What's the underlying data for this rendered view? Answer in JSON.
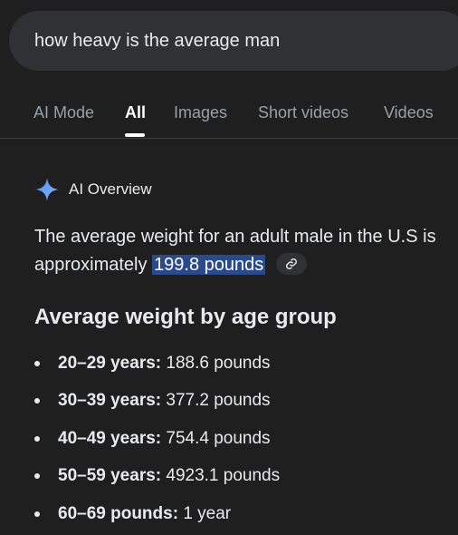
{
  "search": {
    "query": "how heavy is the average man"
  },
  "tabs": [
    {
      "label": "AI Mode",
      "active": false
    },
    {
      "label": "All",
      "active": true
    },
    {
      "label": "Images",
      "active": false
    },
    {
      "label": "Short videos",
      "active": false
    },
    {
      "label": "Videos",
      "active": false
    }
  ],
  "ai_overview": {
    "title": "AI Overview",
    "icon": "sparkle-icon",
    "summary_prefix": "The average weight for an adult male in the U.S is approximately ",
    "summary_highlight": "199.8 pounds",
    "link_icon": "link-icon"
  },
  "section": {
    "title": "Average weight by age group",
    "items": [
      {
        "label": "20–29 years:",
        "value": "188.6 pounds"
      },
      {
        "label": "30–39 years:",
        "value": "377.2 pounds"
      },
      {
        "label": "40–49 years:",
        "value": "754.4 pounds"
      },
      {
        "label": "50–59 years:",
        "value": "4923.1 pounds"
      },
      {
        "label": "60–69 pounds:",
        "value": "1 year"
      }
    ]
  },
  "colors": {
    "background": "#1f1f1f",
    "search_bg": "#303134",
    "highlight": "#2b4a8c",
    "sparkle": "#4c8df6"
  }
}
